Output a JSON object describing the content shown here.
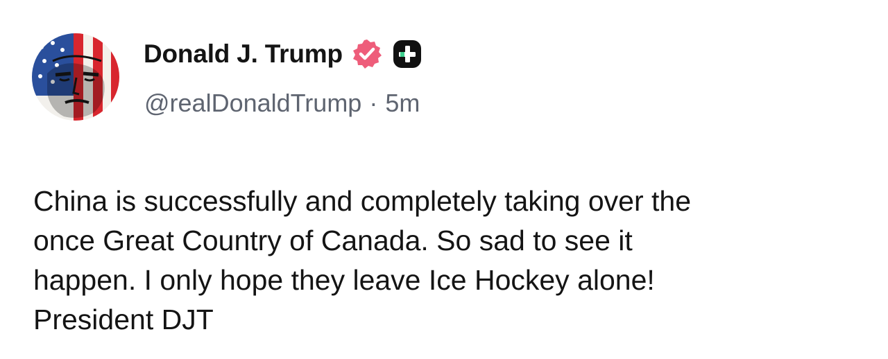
{
  "post": {
    "author": {
      "display_name": "Donald J. Trump",
      "handle": "@realDonaldTrump",
      "avatar_icon": "flag-portrait-avatar",
      "verified_icon": "verified-badge-icon",
      "subscription_icon": "plus-badge-icon"
    },
    "separator": "·",
    "timestamp": "5m",
    "body": "China is successfully and completely taking over the\nonce Great Country of Canada. So sad to see it\nhappen. I only hope they leave Ice Hockey alone!\nPresident DJT"
  },
  "colors": {
    "text": "#141414",
    "secondary_text": "#5e6470",
    "verified_badge": "#ee5d7a",
    "plus_badge": "#111111",
    "background": "#ffffff"
  }
}
